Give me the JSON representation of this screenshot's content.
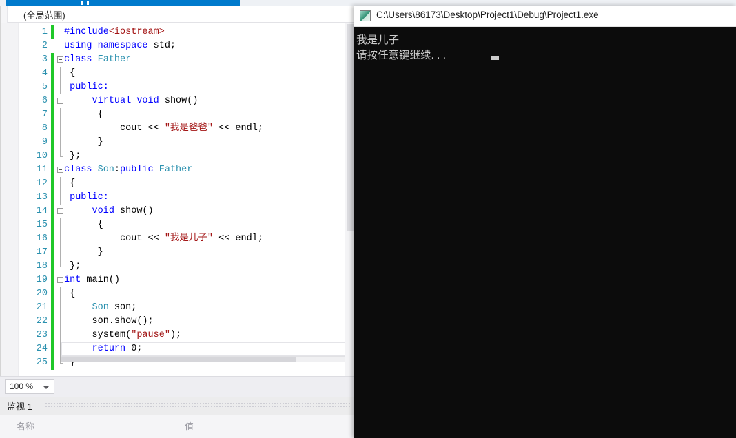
{
  "window": {
    "app": "Visual Studio",
    "scope_bar": "(全局范围)"
  },
  "editor": {
    "zoom_level": "100 %",
    "lines": [
      {
        "num": "1",
        "text": "#include<iostream>",
        "changed": true,
        "fold": false,
        "guide": "none"
      },
      {
        "num": "2",
        "text": "using namespace std;",
        "changed": false,
        "fold": false,
        "guide": "none"
      },
      {
        "num": "3",
        "text": "class Father",
        "changed": true,
        "fold": true,
        "guide": "none"
      },
      {
        "num": "4",
        "text": " {",
        "changed": true,
        "fold": false,
        "guide": "line"
      },
      {
        "num": "5",
        "text": " public:",
        "changed": true,
        "fold": false,
        "guide": "line"
      },
      {
        "num": "6",
        "text": "     virtual void show()",
        "changed": true,
        "fold": true,
        "guide": "none"
      },
      {
        "num": "7",
        "text": "      {",
        "changed": true,
        "fold": false,
        "guide": "line"
      },
      {
        "num": "8",
        "text": "          cout << \"我是爸爸\" << endl;",
        "changed": true,
        "fold": false,
        "guide": "line"
      },
      {
        "num": "9",
        "text": "      }",
        "changed": true,
        "fold": false,
        "guide": "line"
      },
      {
        "num": "10",
        "text": " };",
        "changed": true,
        "fold": false,
        "guide": "endcap"
      },
      {
        "num": "11",
        "text": "class Son:public Father",
        "changed": true,
        "fold": true,
        "guide": "none"
      },
      {
        "num": "12",
        "text": " {",
        "changed": true,
        "fold": false,
        "guide": "line"
      },
      {
        "num": "13",
        "text": " public:",
        "changed": true,
        "fold": false,
        "guide": "line"
      },
      {
        "num": "14",
        "text": "     void show()",
        "changed": true,
        "fold": true,
        "guide": "none"
      },
      {
        "num": "15",
        "text": "      {",
        "changed": true,
        "fold": false,
        "guide": "line"
      },
      {
        "num": "16",
        "text": "          cout << \"我是儿子\" << endl;",
        "changed": true,
        "fold": false,
        "guide": "line"
      },
      {
        "num": "17",
        "text": "      }",
        "changed": true,
        "fold": false,
        "guide": "line"
      },
      {
        "num": "18",
        "text": " };",
        "changed": true,
        "fold": false,
        "guide": "endcap"
      },
      {
        "num": "19",
        "text": "int main()",
        "changed": true,
        "fold": true,
        "guide": "none"
      },
      {
        "num": "20",
        "text": " {",
        "changed": true,
        "fold": false,
        "guide": "line"
      },
      {
        "num": "21",
        "text": "     Son son;",
        "changed": true,
        "fold": false,
        "guide": "line"
      },
      {
        "num": "22",
        "text": "     son.show();",
        "changed": true,
        "fold": false,
        "guide": "line"
      },
      {
        "num": "23",
        "text": "     system(\"pause\");",
        "changed": true,
        "fold": false,
        "guide": "line"
      },
      {
        "num": "24",
        "text": "     return 0;",
        "changed": true,
        "fold": false,
        "guide": "line"
      },
      {
        "num": "25",
        "text": " }",
        "changed": true,
        "fold": false,
        "guide": "endcap"
      }
    ],
    "tokens": [
      [
        [
          "pp",
          "#include"
        ],
        [
          "str",
          "<iostream>"
        ]
      ],
      [
        [
          "kw",
          "using namespace "
        ],
        [
          "plain",
          "std;"
        ]
      ],
      [
        [
          "kw",
          "class "
        ],
        [
          "type",
          "Father"
        ]
      ],
      [
        [
          "plain",
          " {"
        ]
      ],
      [
        [
          "kw",
          " public:"
        ]
      ],
      [
        [
          "plain",
          "     "
        ],
        [
          "kw",
          "virtual void "
        ],
        [
          "plain",
          "show()"
        ]
      ],
      [
        [
          "plain",
          "      {"
        ]
      ],
      [
        [
          "plain",
          "          cout << "
        ],
        [
          "str",
          "\"我是爸爸\""
        ],
        [
          "plain",
          " << endl;"
        ]
      ],
      [
        [
          "plain",
          "      }"
        ]
      ],
      [
        [
          "plain",
          " };"
        ]
      ],
      [
        [
          "kw",
          "class "
        ],
        [
          "type",
          "Son"
        ],
        [
          "plain",
          ":"
        ],
        [
          "kw",
          "public "
        ],
        [
          "type",
          "Father"
        ]
      ],
      [
        [
          "plain",
          " {"
        ]
      ],
      [
        [
          "kw",
          " public:"
        ]
      ],
      [
        [
          "plain",
          "     "
        ],
        [
          "kw",
          "void "
        ],
        [
          "plain",
          "show()"
        ]
      ],
      [
        [
          "plain",
          "      {"
        ]
      ],
      [
        [
          "plain",
          "          cout << "
        ],
        [
          "str",
          "\"我是儿子\""
        ],
        [
          "plain",
          " << endl;"
        ]
      ],
      [
        [
          "plain",
          "      }"
        ]
      ],
      [
        [
          "plain",
          " };"
        ]
      ],
      [
        [
          "kw",
          "int "
        ],
        [
          "plain",
          "main()"
        ]
      ],
      [
        [
          "plain",
          " {"
        ]
      ],
      [
        [
          "plain",
          "     "
        ],
        [
          "type",
          "Son"
        ],
        [
          "plain",
          " son;"
        ]
      ],
      [
        [
          "plain",
          "     son.show();"
        ]
      ],
      [
        [
          "plain",
          "     system("
        ],
        [
          "str",
          "\"pause\""
        ],
        [
          "plain",
          ");"
        ]
      ],
      [
        [
          "plain",
          "     "
        ],
        [
          "kw",
          "return "
        ],
        [
          "plain",
          "0;"
        ]
      ],
      [
        [
          "plain",
          " }"
        ]
      ]
    ]
  },
  "watch": {
    "tab_label": "监视 1",
    "columns": {
      "name": "名称",
      "value": "值"
    }
  },
  "console": {
    "title": "C:\\Users\\86173\\Desktop\\Project1\\Debug\\Project1.exe",
    "output": [
      "我是儿子",
      "请按任意键继续. . ."
    ]
  },
  "colors": {
    "accent_blue": "#007acc",
    "keyword": "#0000ff",
    "type": "#2b91af",
    "string": "#a31515",
    "line_number": "#2b91af",
    "change_bar": "#1fc829",
    "console_bg": "#0c0c0c",
    "console_fg": "#cccccc"
  }
}
